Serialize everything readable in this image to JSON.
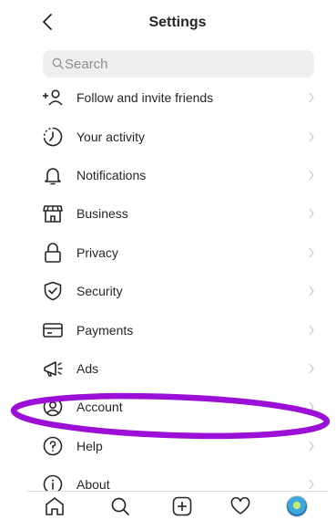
{
  "header": {
    "title": "Settings"
  },
  "search": {
    "placeholder": "Search",
    "value": ""
  },
  "menu": [
    {
      "label": "Follow and invite friends",
      "icon": "add-person-icon"
    },
    {
      "label": "Your activity",
      "icon": "activity-icon"
    },
    {
      "label": "Notifications",
      "icon": "bell-icon"
    },
    {
      "label": "Business",
      "icon": "shop-icon"
    },
    {
      "label": "Privacy",
      "icon": "lock-icon"
    },
    {
      "label": "Security",
      "icon": "shield-check-icon"
    },
    {
      "label": "Payments",
      "icon": "credit-card-icon"
    },
    {
      "label": "Ads",
      "icon": "megaphone-icon"
    },
    {
      "label": "Account",
      "icon": "account-circle-icon"
    },
    {
      "label": "Help",
      "icon": "help-icon"
    },
    {
      "label": "About",
      "icon": "info-icon"
    }
  ],
  "tabbar": [
    "home-icon",
    "search-icon",
    "new-post-icon",
    "heart-icon",
    "profile-avatar"
  ],
  "colors": {
    "text": "#262626",
    "secondary": "#8e8e8e",
    "search_bg": "#efefef",
    "highlight": "#9b0fd6"
  }
}
